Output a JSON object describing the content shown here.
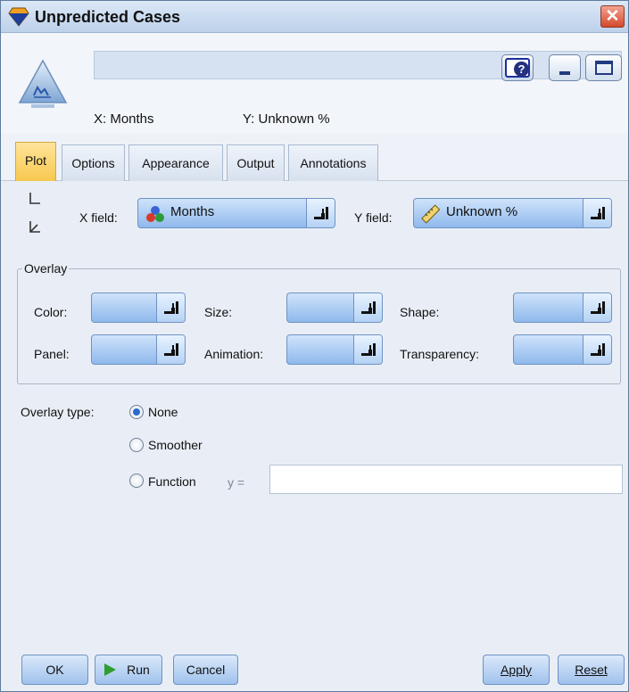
{
  "window": {
    "title": "Unpredicted Cases",
    "close_glyph": "✕"
  },
  "header": {
    "name_value": "",
    "x_info": "X: Months",
    "y_info": "Y: Unknown %",
    "help_glyph": "?"
  },
  "tabs": [
    {
      "label": "Plot",
      "active": true
    },
    {
      "label": "Options"
    },
    {
      "label": "Appearance"
    },
    {
      "label": "Output"
    },
    {
      "label": "Annotations"
    }
  ],
  "plot": {
    "x_field_label": "X field:",
    "x_field_value": "Months",
    "y_field_label": "Y field:",
    "y_field_value": "Unknown %",
    "overlay": {
      "title": "Overlay",
      "color_label": "Color:",
      "size_label": "Size:",
      "shape_label": "Shape:",
      "panel_label": "Panel:",
      "animation_label": "Animation:",
      "transparency_label": "Transparency:"
    },
    "overlay_type_label": "Overlay type:",
    "overlay_type_options": [
      "None",
      "Smoother",
      "Function"
    ],
    "overlay_type_selected": "None",
    "function_prefix": "y =",
    "function_value": ""
  },
  "buttons": {
    "ok": "OK",
    "run": "Run",
    "cancel": "Cancel",
    "apply": "Apply",
    "reset": "Reset"
  },
  "colors": {
    "active_tab": "#f7c84f",
    "field_blue": "#8fb9ec",
    "run_green": "#2f9e2f"
  }
}
